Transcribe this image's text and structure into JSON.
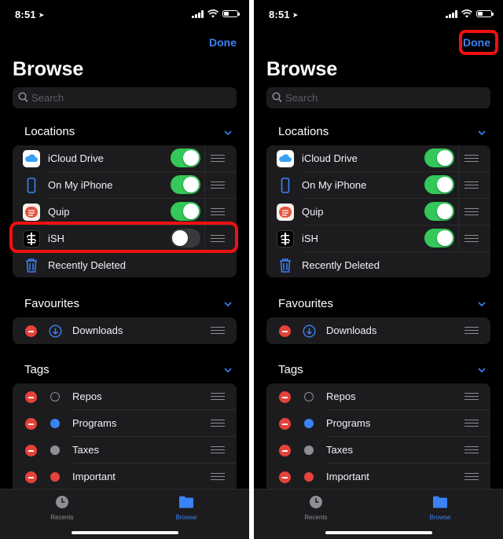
{
  "screens": [
    {
      "status": {
        "time": "8:51"
      },
      "done_label": "Done",
      "done_highlighted": false,
      "title": "Browse",
      "search_placeholder": "Search",
      "locations": {
        "header": "Locations",
        "items": [
          {
            "label": "iCloud Drive",
            "icon": "icloud-icon",
            "toggle": true
          },
          {
            "label": "On My iPhone",
            "icon": "iphone-icon",
            "toggle": true
          },
          {
            "label": "Quip",
            "icon": "quip-icon",
            "toggle": true
          },
          {
            "label": "iSH",
            "icon": "ish-icon",
            "toggle": false
          },
          {
            "label": "Recently Deleted",
            "icon": "trash-icon"
          }
        ]
      },
      "favourites": {
        "header": "Favourites",
        "items": [
          {
            "label": "Downloads",
            "icon": "download-icon"
          }
        ]
      },
      "tags": {
        "header": "Tags",
        "items": [
          {
            "label": "Repos",
            "color": "none"
          },
          {
            "label": "Programs",
            "color": "#3b82f6"
          },
          {
            "label": "Taxes",
            "color": "#8e8e93"
          },
          {
            "label": "Important",
            "color": "#e5433a"
          }
        ]
      },
      "tabbar": {
        "recents": "Recents",
        "browse": "Browse"
      }
    },
    {
      "status": {
        "time": "8:51"
      },
      "done_label": "Done",
      "done_highlighted": true,
      "title": "Browse",
      "search_placeholder": "Search",
      "locations": {
        "header": "Locations",
        "items": [
          {
            "label": "iCloud Drive",
            "icon": "icloud-icon",
            "toggle": true
          },
          {
            "label": "On My iPhone",
            "icon": "iphone-icon",
            "toggle": true
          },
          {
            "label": "Quip",
            "icon": "quip-icon",
            "toggle": true
          },
          {
            "label": "iSH",
            "icon": "ish-icon",
            "toggle": true
          },
          {
            "label": "Recently Deleted",
            "icon": "trash-icon"
          }
        ]
      },
      "favourites": {
        "header": "Favourites",
        "items": [
          {
            "label": "Downloads",
            "icon": "download-icon"
          }
        ]
      },
      "tags": {
        "header": "Tags",
        "items": [
          {
            "label": "Repos",
            "color": "none"
          },
          {
            "label": "Programs",
            "color": "#3b82f6"
          },
          {
            "label": "Taxes",
            "color": "#8e8e93"
          },
          {
            "label": "Important",
            "color": "#e5433a"
          }
        ]
      },
      "tabbar": {
        "recents": "Recents",
        "browse": "Browse"
      }
    }
  ],
  "colors": {
    "accent": "#3b82f6",
    "toggle_on": "#34c759",
    "destructive": "#e5433a",
    "highlight": "#ee1111"
  }
}
